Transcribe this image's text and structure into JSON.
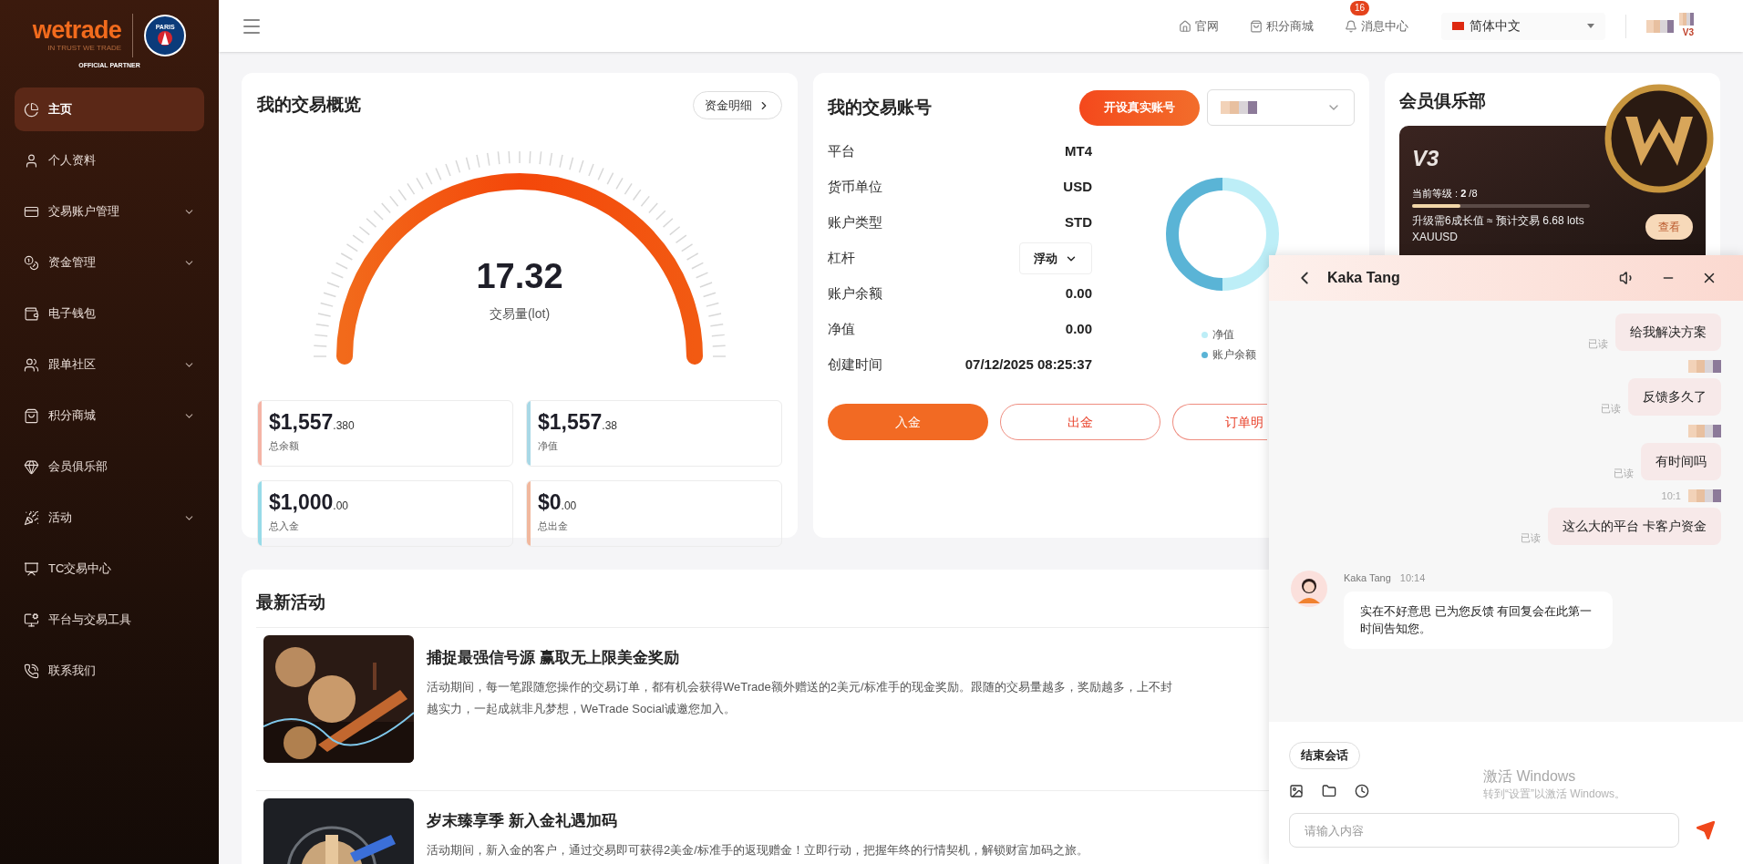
{
  "logo": {
    "brand": "wetrade",
    "tagline": "IN TRUST WE TRADE",
    "crest_text": "PARIS",
    "partner": "OFFICIAL PARTNER"
  },
  "sidebar": {
    "items": [
      {
        "label": "主页",
        "selected": true,
        "has_submenu": false
      },
      {
        "label": "个人资料",
        "selected": false,
        "has_submenu": false
      },
      {
        "label": "交易账户管理",
        "selected": false,
        "has_submenu": true
      },
      {
        "label": "资金管理",
        "selected": false,
        "has_submenu": true
      },
      {
        "label": "电子钱包",
        "selected": false,
        "has_submenu": false
      },
      {
        "label": "跟单社区",
        "selected": false,
        "has_submenu": true
      },
      {
        "label": "积分商城",
        "selected": false,
        "has_submenu": true
      },
      {
        "label": "会员俱乐部",
        "selected": false,
        "has_submenu": false
      },
      {
        "label": "活动",
        "selected": false,
        "has_submenu": true
      },
      {
        "label": "TC交易中心",
        "selected": false,
        "has_submenu": false
      },
      {
        "label": "平台与交易工具",
        "selected": false,
        "has_submenu": false
      },
      {
        "label": "联系我们",
        "selected": false,
        "has_submenu": false
      }
    ]
  },
  "header": {
    "links": [
      "官网",
      "积分商城",
      "消息中心"
    ],
    "notification_count": "16",
    "language": "简体中文",
    "user_level": "V3"
  },
  "overview": {
    "title": "我的交易概览",
    "details_button": "资金明细",
    "gauge": {
      "level": 1,
      "value": "17.32",
      "label": "交易量(lot)"
    },
    "stats": [
      {
        "amount": "$1,557",
        "decimals": ".380",
        "label": "总余额",
        "color": "#f4b4a6"
      },
      {
        "amount": "$1,557",
        "decimals": ".38",
        "label": "净值",
        "color": "#a8d8e6"
      },
      {
        "amount": "$1,000",
        "decimals": ".00",
        "label": "总入金",
        "color": "#98dbe8"
      },
      {
        "amount": "$0",
        "decimals": ".00",
        "label": "总出金",
        "color": "#f1b89e"
      }
    ]
  },
  "account": {
    "title": "我的交易账号",
    "open_button": "开设真实账号",
    "rows": [
      {
        "kind": "text",
        "label": "平台",
        "value": "MT4"
      },
      {
        "kind": "text",
        "label": "货币单位",
        "value": "USD"
      },
      {
        "kind": "text",
        "label": "账户类型",
        "value": "STD"
      },
      {
        "kind": "select",
        "label": "杠杆",
        "value": "浮动"
      },
      {
        "kind": "text",
        "label": "账户余额",
        "value": "0.00"
      },
      {
        "kind": "text",
        "label": "净值",
        "value": "0.00"
      },
      {
        "kind": "text",
        "label": "创建时间",
        "value": "07/12/2025 08:25:37"
      }
    ],
    "legend": [
      {
        "label": "净值",
        "color": "#bdeef7"
      },
      {
        "label": "账户余额",
        "color": "#5ab4d6"
      }
    ],
    "buttons": [
      {
        "label": "入金",
        "kind": "primary"
      },
      {
        "label": "出金",
        "kind": "outline"
      },
      {
        "label": "订单明",
        "kind": "outline"
      }
    ]
  },
  "club": {
    "title": "会员俱乐部",
    "level_name": "V3",
    "current_level": "当前等级 : **2** /8",
    "progress": {
      "level": 0.27
    },
    "upgrade_text": "升级需6成长值 ≈ 预计交易 6.68 lots",
    "symbol": "XAUUSD",
    "view_button": "查看"
  },
  "activities": {
    "title": "最新活动",
    "items": [
      {
        "title": "捕捉最强信号源 赢取无上限美金奖励",
        "lines": [
          "活动期间，每一笔跟随您操作的交易订单，都有机会获得WeTrade额外赠送的2美元/标准手的现金奖励。跟随的交易量越多，奖励越多，上不封",
          "越实力，一起成就非凡梦想，WeTrade Social诚邀您加入。"
        ]
      },
      {
        "title": "岁末臻享季 新入金礼遇加码",
        "lines": [
          "活动期间，新入金的客户，通过交易即可获得2美金/标准手的返现赠金！立即行动，把握年终的行情契机，解锁财富加码之旅。"
        ]
      }
    ]
  },
  "chat": {
    "title": "Kaka Tang",
    "messages": [
      {
        "kind": "sent",
        "text": "给我解决方案",
        "status": "已读"
      },
      {
        "kind": "sent",
        "text": "反馈多久了",
        "status": "已读"
      },
      {
        "kind": "sent",
        "text": "有时间吗",
        "status": "已读"
      },
      {
        "kind": "sent",
        "time": "10:1",
        "text": "这么大的平台 卡客户资金",
        "status": "已读"
      },
      {
        "kind": "received",
        "sender": "Kaka Tang",
        "time": "10:14",
        "text": "实在不好意思 已为您反馈 有回复会在此第一时间告知您。"
      }
    ],
    "end_button": "结束会话",
    "input_placeholder": "请输入内容"
  },
  "os_notice": {
    "title": "激活 Windows",
    "text": "转到“设置”以激活 Windows。"
  }
}
